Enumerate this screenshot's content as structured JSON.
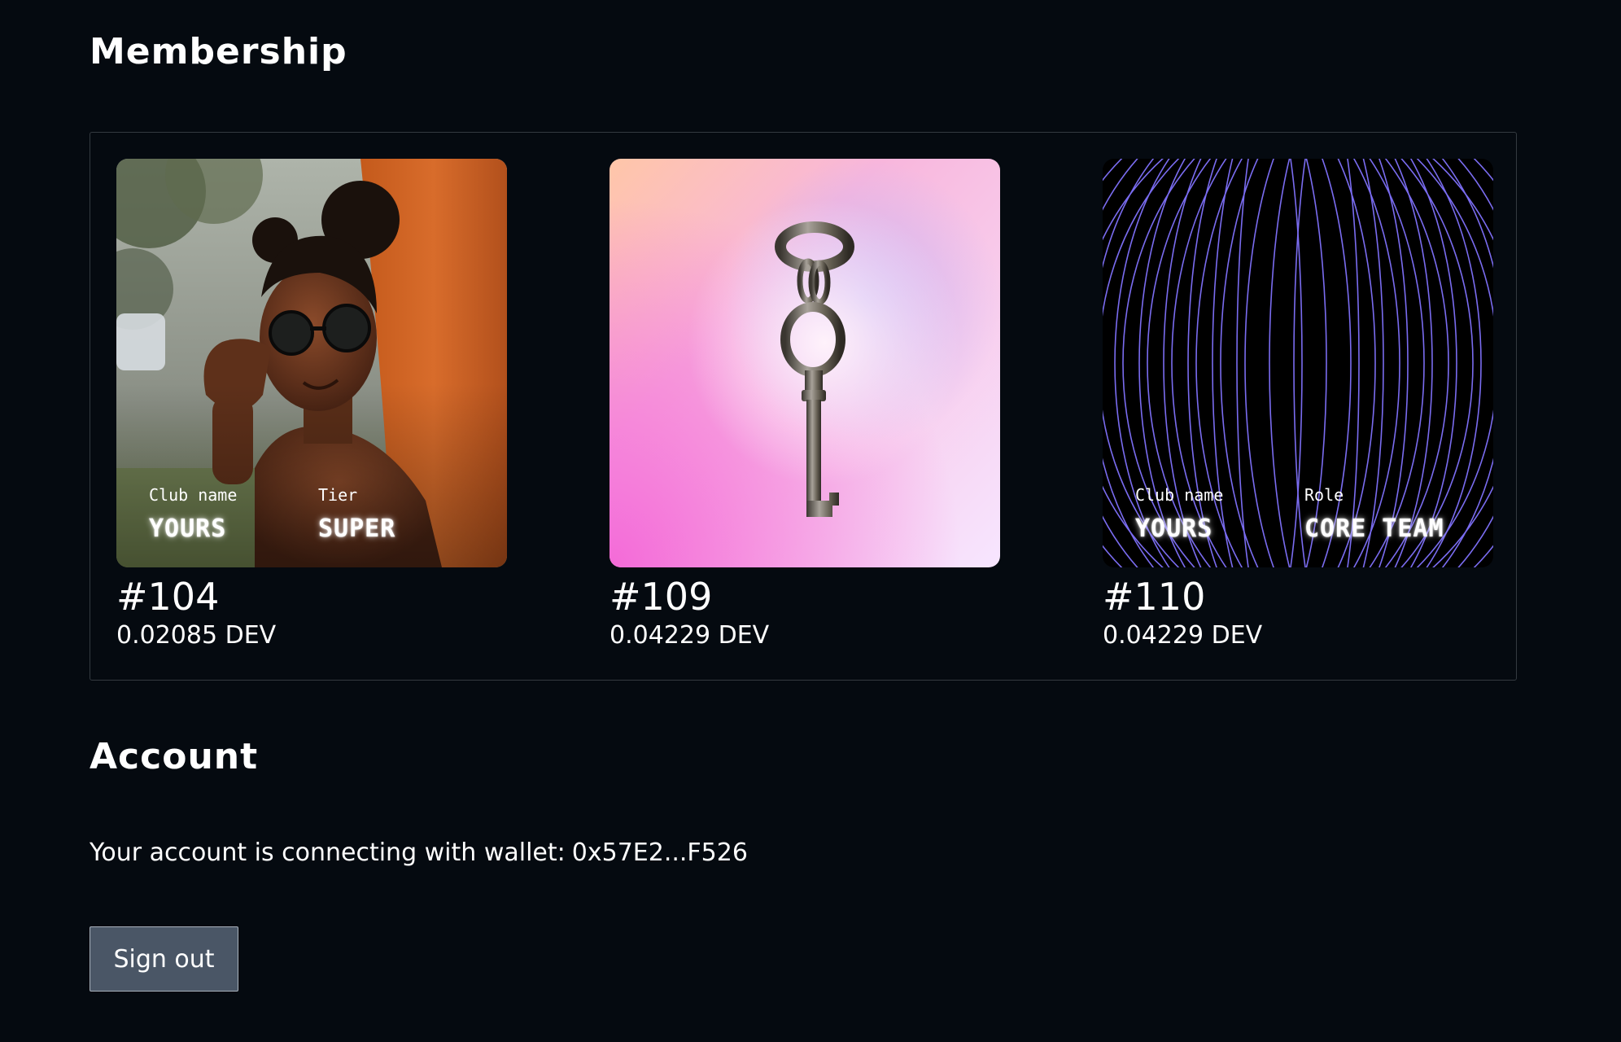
{
  "membership": {
    "title": "Membership",
    "cards": [
      {
        "image": "photo-woman-sunglasses",
        "fields": [
          {
            "label": "Club name",
            "value": "YOURS"
          },
          {
            "label": "Tier",
            "value": "SUPER"
          }
        ],
        "id": "#104",
        "price": "0.02085 DEV"
      },
      {
        "image": "key-on-pink-gradient",
        "fields": [],
        "id": "#109",
        "price": "0.04229 DEV"
      },
      {
        "image": "purple-concentric-arcs",
        "fields": [
          {
            "label": "Club name",
            "value": "YOURS"
          },
          {
            "label": "Role",
            "value": "CORE TEAM"
          }
        ],
        "id": "#110",
        "price": "0.04229 DEV"
      }
    ]
  },
  "account": {
    "title": "Account",
    "wallet_text": "Your account is connecting with wallet:",
    "wallet_address": "0x57E2...F526",
    "signout_label": "Sign out"
  },
  "colors": {
    "background": "#050a10",
    "panel_border": "#343a40",
    "button_bg": "#4a5666",
    "arc_color": "#7a6cf0"
  }
}
